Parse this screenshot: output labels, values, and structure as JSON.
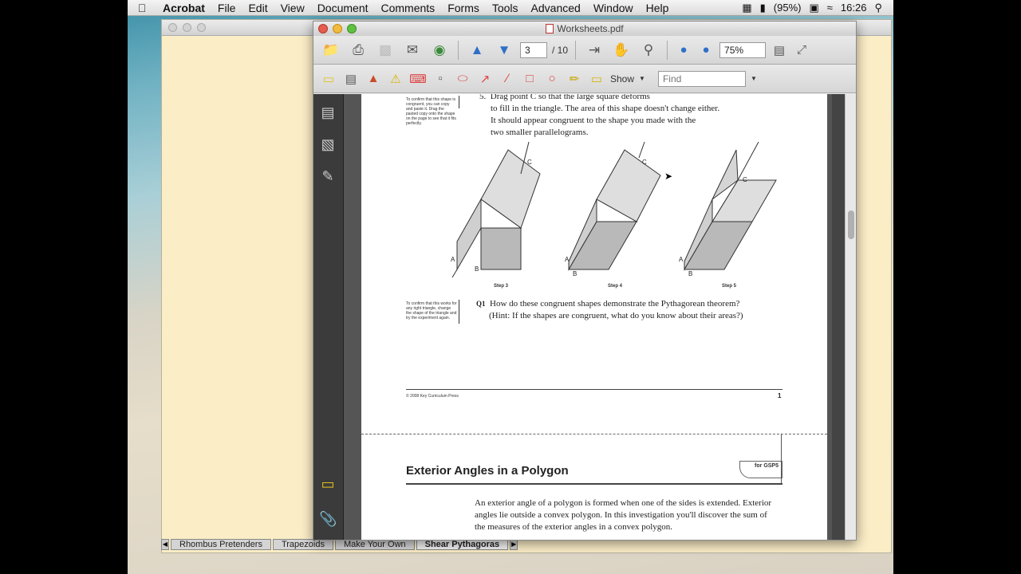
{
  "menubar": {
    "app_name": "Acrobat",
    "items": [
      "File",
      "Edit",
      "View",
      "Document",
      "Comments",
      "Forms",
      "Tools",
      "Advanced",
      "Window",
      "Help"
    ],
    "battery": "(95%)",
    "clock": "16:26"
  },
  "acrobat": {
    "title": "Worksheets.pdf",
    "page_current": "3",
    "page_total": "/ 10",
    "zoom": "75%",
    "show_label": "Show",
    "find_placeholder": "Find"
  },
  "document": {
    "step5_num": "5.",
    "step5_lines": [
      "Drag point C so that the large square deforms",
      "to fill in the triangle. The area of this shape doesn't change either.",
      "It should appear congruent to the shape you made with the",
      "two smaller parallelograms."
    ],
    "side_note_1": "To confirm that this shape is congruent, you can copy and paste it. Drag the pasted copy onto the shape on the page to see that it fits perfectly.",
    "side_note_2": "To confirm that this works for any right triangle, change the shape of the triangle and try the experiment again.",
    "step_labels": [
      "Step 3",
      "Step 4",
      "Step 5"
    ],
    "q1_label": "Q1",
    "q1_text": "How do these congruent shapes demonstrate the Pythagorean theorem?",
    "q1_hint": "(Hint: If the shapes are congruent, what do you know about their areas?)",
    "footer_left": "© 2008 Key Curriculum Press",
    "footer_page": "1",
    "section_title": "Exterior Angles in a Polygon",
    "logo_text": "for GSP5",
    "intro_lines": [
      "An exterior angle of a polygon is formed when one of the sides is extended. Exterior",
      "angles lie outside a convex polygon. In this investigation you'll discover the sum of",
      "the measures of the exterior angles in a convex polygon."
    ]
  },
  "tabs": [
    "Rhombus Pretenders",
    "Trapezoids",
    "Make Your Own",
    "Shear Pythagoras"
  ]
}
